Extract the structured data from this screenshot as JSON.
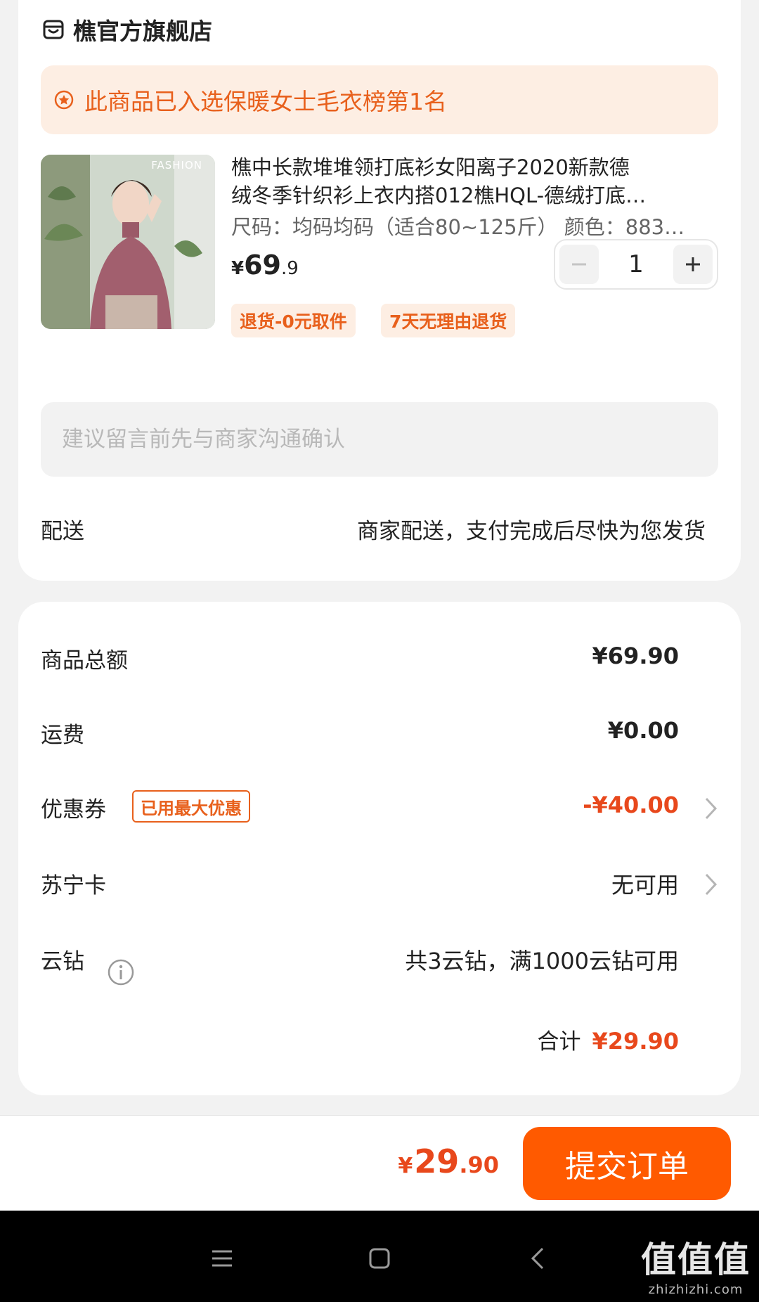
{
  "store": {
    "name": "樵官方旗舰店",
    "icon": "store-icon"
  },
  "banner": {
    "icon": "star-badge-icon",
    "text": "此商品已入选保暖女士毛衣榜第1名"
  },
  "product": {
    "image_caption": "FASHION",
    "title_line1": "樵中长款堆堆领打底衫女阳离子2020新款德",
    "title_line2": "绒冬季针织衫上衣内搭012樵HQL-德绒打底…",
    "spec": "尺码：均码均码（适合80~125斤） 颜色：883…",
    "price_currency": "¥",
    "price_int": "69",
    "price_dec": ".9",
    "quantity": "1",
    "tags": [
      "退货-0元取件",
      "7天无理由退货"
    ]
  },
  "message": {
    "placeholder": "建议留言前先与商家沟通确认"
  },
  "shipping": {
    "label": "配送",
    "value": "商家配送，支付完成后尽快为您发货"
  },
  "summary": {
    "goods_total_label": "商品总额",
    "goods_total_value": "¥69.90",
    "freight_label": "运费",
    "freight_value": "¥0.00",
    "coupon_label": "优惠券",
    "coupon_badge": "已用最大优惠",
    "coupon_value": "-¥40.00",
    "card_label": "苏宁卡",
    "card_value": "无可用",
    "diamond_label": "云钻",
    "diamond_value": "共3云钻，满1000云钻可用",
    "total_label": "合计",
    "total_value": "¥29.90"
  },
  "bottom": {
    "currency": "¥",
    "pay_int": "29",
    "pay_dec": ".90",
    "submit_label": "提交订单"
  },
  "watermark": {
    "big": "值值值",
    "small": "zhizhizhi.com"
  },
  "colors": {
    "accent": "#ff5a00",
    "price_red": "#e8481c",
    "tag_bg": "#fdeee3"
  }
}
